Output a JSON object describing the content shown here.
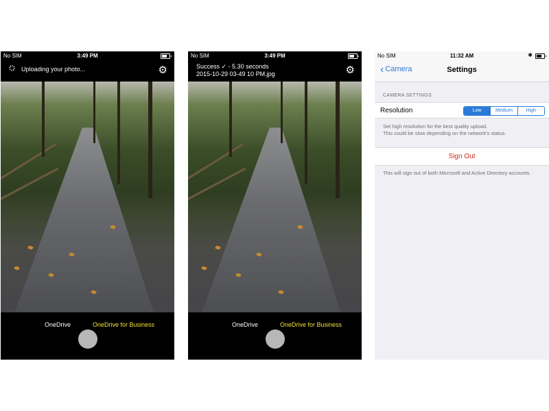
{
  "phone1": {
    "status": {
      "carrier": "No SIM",
      "time": "3:49 PM"
    },
    "message": "Uploading your photo...",
    "tabs": {
      "onedrive": "OneDrive",
      "business": "OneDrive for Business"
    }
  },
  "phone2": {
    "status": {
      "carrier": "No SIM",
      "time": "3:49 PM"
    },
    "message_line1": "Success ✓ - 5.30 seconds",
    "message_line2": "2015-10-29 03-49 10 PM.jpg",
    "tabs": {
      "onedrive": "OneDrive",
      "business": "OneDrive for Business"
    }
  },
  "phone3": {
    "status": {
      "carrier": "No SIM",
      "time": "11:32 AM"
    },
    "nav": {
      "back_label": "Camera",
      "title": "Settings"
    },
    "section_header": "CAMERA SETTINGS",
    "resolution": {
      "label": "Resolution",
      "options": [
        "Low",
        "Medium",
        "High"
      ],
      "selected": "Low"
    },
    "resolution_note": "Set high resolution for the best quality upload.\nThis could be slow depending on the network's status.",
    "sign_out": "Sign Out",
    "sign_out_note": "This will sign out of both Microsoft and Active Directory accounts."
  },
  "colors": {
    "active_tab": "#f4e23a",
    "ios_blue": "#2a7ad6",
    "destructive": "#d0281e"
  },
  "icons": [
    "spinner-icon",
    "gear-icon",
    "battery-icon",
    "bluetooth-icon",
    "chevron-left-icon"
  ]
}
